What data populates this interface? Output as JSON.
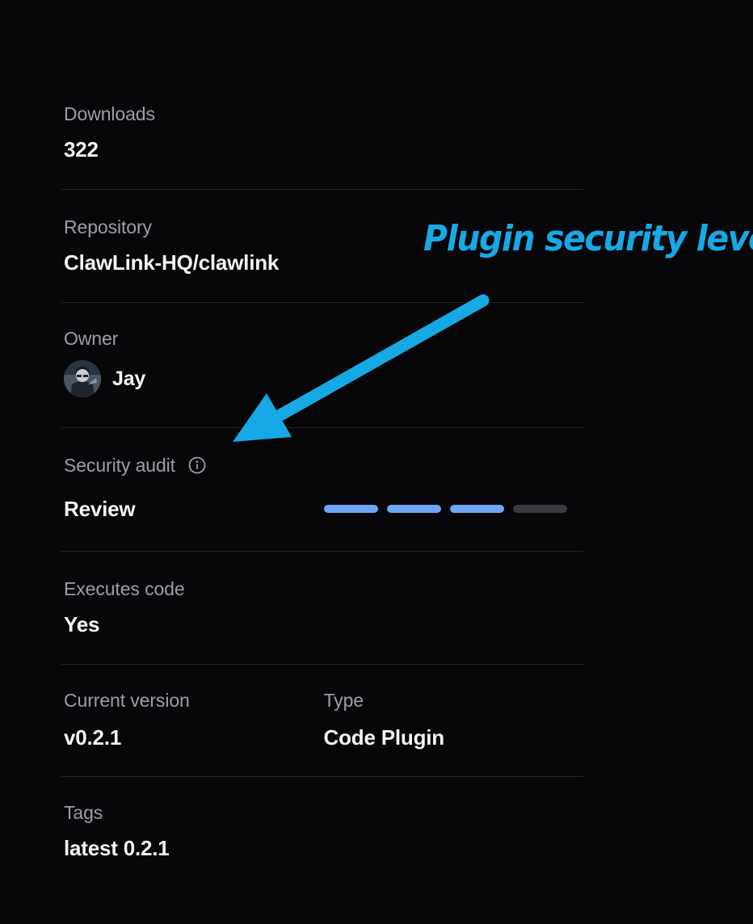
{
  "details": {
    "downloads": {
      "label": "Downloads",
      "value": "322"
    },
    "repository": {
      "label": "Repository",
      "value": "ClawLink-HQ/clawlink"
    },
    "owner": {
      "label": "Owner",
      "name": "Jay"
    },
    "security_audit": {
      "label": "Security audit",
      "value": "Review",
      "info_icon": "info-circle-icon",
      "level": 3,
      "level_max": 4,
      "active_color": "#6ea6f5",
      "inactive_color": "#3a3a40"
    },
    "executes_code": {
      "label": "Executes code",
      "value": "Yes"
    },
    "current_version": {
      "label": "Current version",
      "value": "v0.2.1"
    },
    "type": {
      "label": "Type",
      "value": "Code Plugin"
    },
    "tags": {
      "label": "Tags",
      "value": "latest 0.2.1"
    }
  },
  "annotation": {
    "text": "Plugin security level",
    "color": "#16a9e6"
  }
}
